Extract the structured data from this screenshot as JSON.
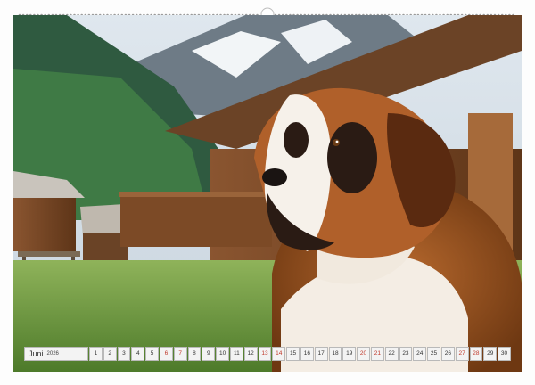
{
  "calendar": {
    "month": "Juni",
    "year": "2026",
    "days": [
      "1",
      "2",
      "3",
      "4",
      "5",
      "6",
      "7",
      "8",
      "9",
      "10",
      "11",
      "12",
      "13",
      "14",
      "15",
      "16",
      "17",
      "18",
      "19",
      "20",
      "21",
      "22",
      "23",
      "24",
      "25",
      "26",
      "27",
      "28",
      "29",
      "30"
    ],
    "weekend_days": [
      "6",
      "7",
      "13",
      "14",
      "20",
      "21",
      "27",
      "28"
    ]
  },
  "colors": {
    "weekend": "#c0392b",
    "ring": "#9a9a9a"
  }
}
